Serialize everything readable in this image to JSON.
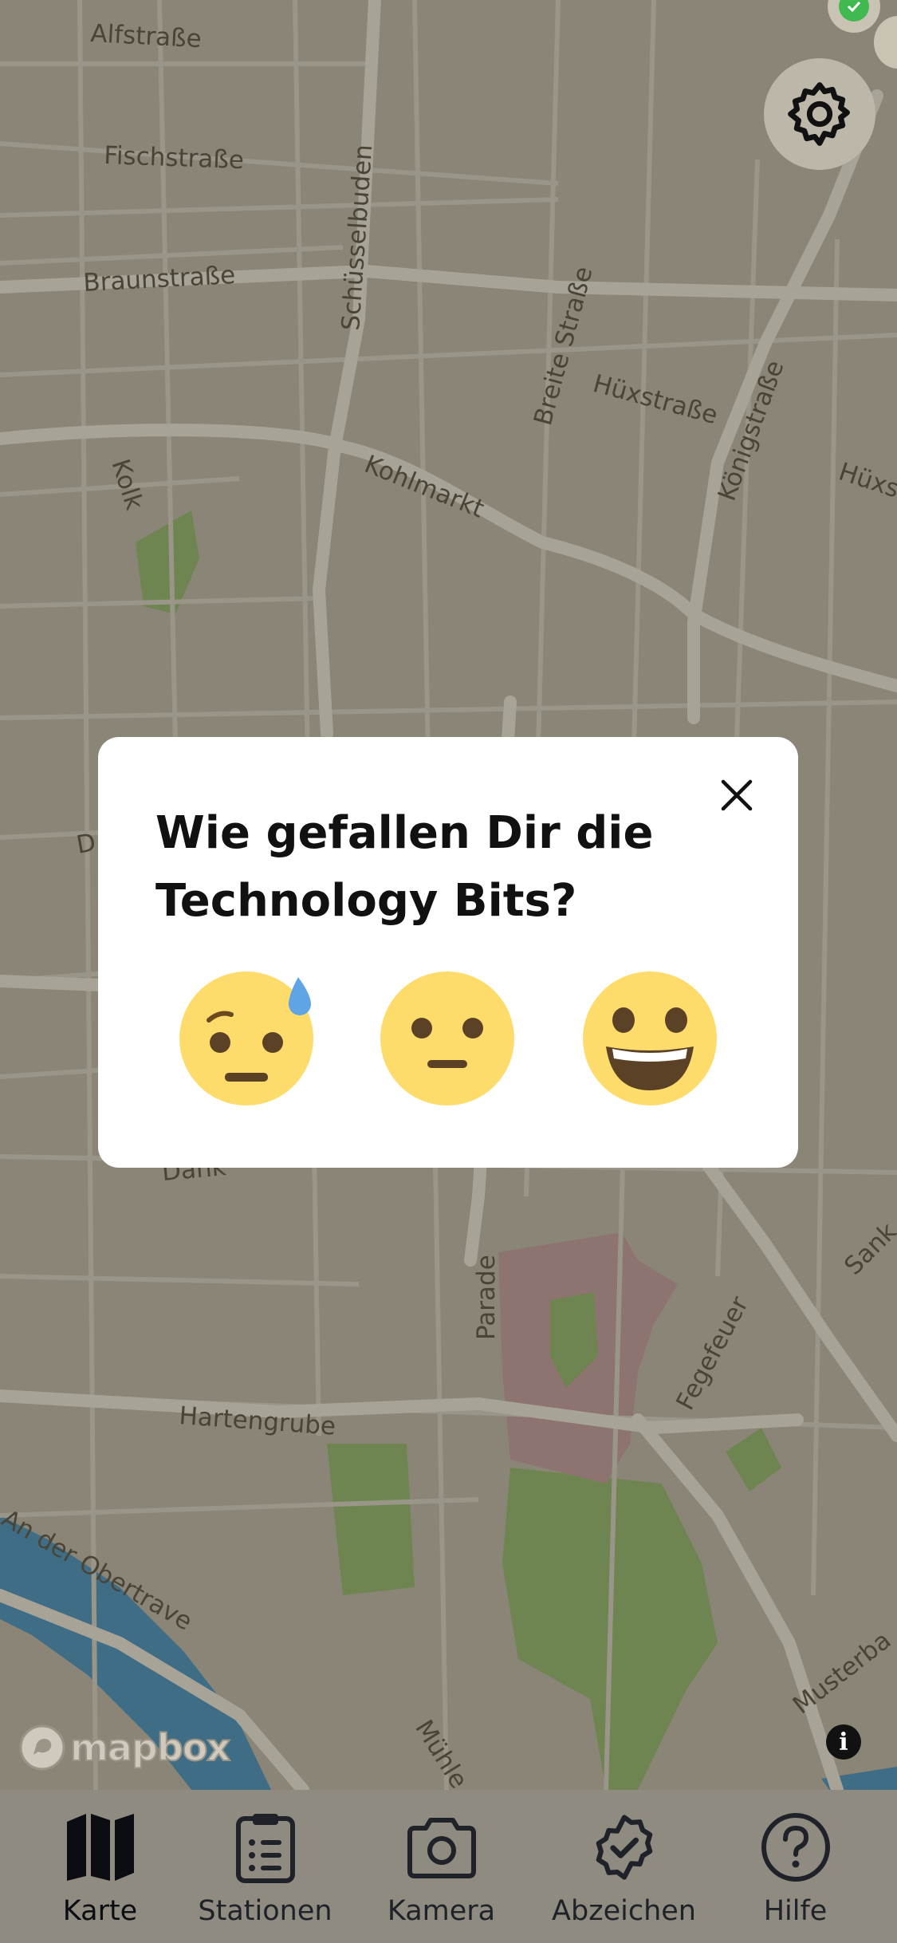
{
  "map": {
    "streets": [
      {
        "name": "Alfstraße"
      },
      {
        "name": "Fischstraße"
      },
      {
        "name": "Braunstraße"
      },
      {
        "name": "Schüsselbuden"
      },
      {
        "name": "Breite Straße"
      },
      {
        "name": "Hüxstraße"
      },
      {
        "name": "Königstraße"
      },
      {
        "name": "Hüxs"
      },
      {
        "name": "Kolk"
      },
      {
        "name": "Kohlmarkt"
      },
      {
        "name": "D"
      },
      {
        "name": "Dank"
      },
      {
        "name": "Parade"
      },
      {
        "name": "Fegefeuer"
      },
      {
        "name": "Sank"
      },
      {
        "name": "Hartengrube"
      },
      {
        "name": "An der Obertrave"
      },
      {
        "name": "Mühle"
      },
      {
        "name": "Musterba"
      }
    ],
    "attribution": "mapbox",
    "colors": {
      "background": "#8a8576",
      "road": "#a8a397",
      "park": "#6f8551",
      "water": "#3f6d86",
      "landmark": "#8e7470"
    }
  },
  "controls": {
    "settings_icon": "gear-icon",
    "info_icon": "info-icon",
    "info_glyph": "i"
  },
  "feedback_modal": {
    "title": "Wie gefallen Dir die Technology Bits?",
    "close_icon": "close-icon",
    "options": [
      {
        "icon": "sweat-face-icon",
        "meaning": "negative"
      },
      {
        "icon": "neutral-face-icon",
        "meaning": "neutral"
      },
      {
        "icon": "grinning-face-icon",
        "meaning": "positive"
      }
    ]
  },
  "tab_bar": {
    "items": [
      {
        "label": "Karte",
        "icon": "map-icon",
        "active": true
      },
      {
        "label": "Stationen",
        "icon": "clipboard-list-icon",
        "active": false
      },
      {
        "label": "Kamera",
        "icon": "camera-icon",
        "active": false
      },
      {
        "label": "Abzeichen",
        "icon": "badge-check-icon",
        "active": false
      },
      {
        "label": "Hilfe",
        "icon": "help-icon",
        "active": false
      }
    ]
  }
}
